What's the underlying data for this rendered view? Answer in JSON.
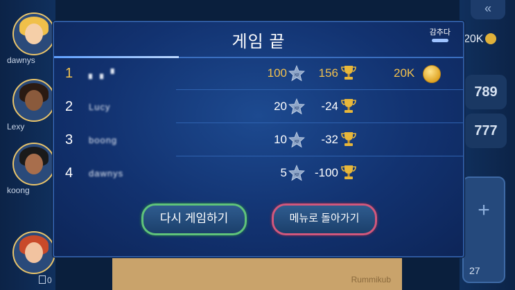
{
  "background": {
    "players": [
      {
        "name": "dawnys",
        "cards": ""
      },
      {
        "name": "Lexy",
        "cards": ""
      },
      {
        "name": "koong",
        "cards": ""
      },
      {
        "name": "",
        "cards": "0"
      }
    ],
    "back_icon": "double-chevron-left-icon",
    "coins": "20K",
    "scores": [
      "789",
      "777"
    ],
    "draw_pile_count": "27",
    "table_logo": "Rummikub"
  },
  "modal": {
    "title": "게임 끝",
    "skip_label": "감추다",
    "results": [
      {
        "rank": "1",
        "name": "▖▗ ▝",
        "xp": "100",
        "trophy": "156",
        "coins": "20K",
        "highlight": true
      },
      {
        "rank": "2",
        "name": "Lucy",
        "xp": "20",
        "trophy": "-24",
        "coins": ""
      },
      {
        "rank": "3",
        "name": "boong",
        "xp": "10",
        "trophy": "-32",
        "coins": ""
      },
      {
        "rank": "4",
        "name": "dawnys",
        "xp": "5",
        "trophy": "-100",
        "coins": ""
      }
    ],
    "xp_icon_label": "xp",
    "play_again_label": "다시 게임하기",
    "back_to_menu_label": "메뉴로 돌아가기"
  },
  "colors": {
    "gold": "#f2c14e",
    "play_again_border": "#5fc37a",
    "menu_border": "#d1577c"
  }
}
